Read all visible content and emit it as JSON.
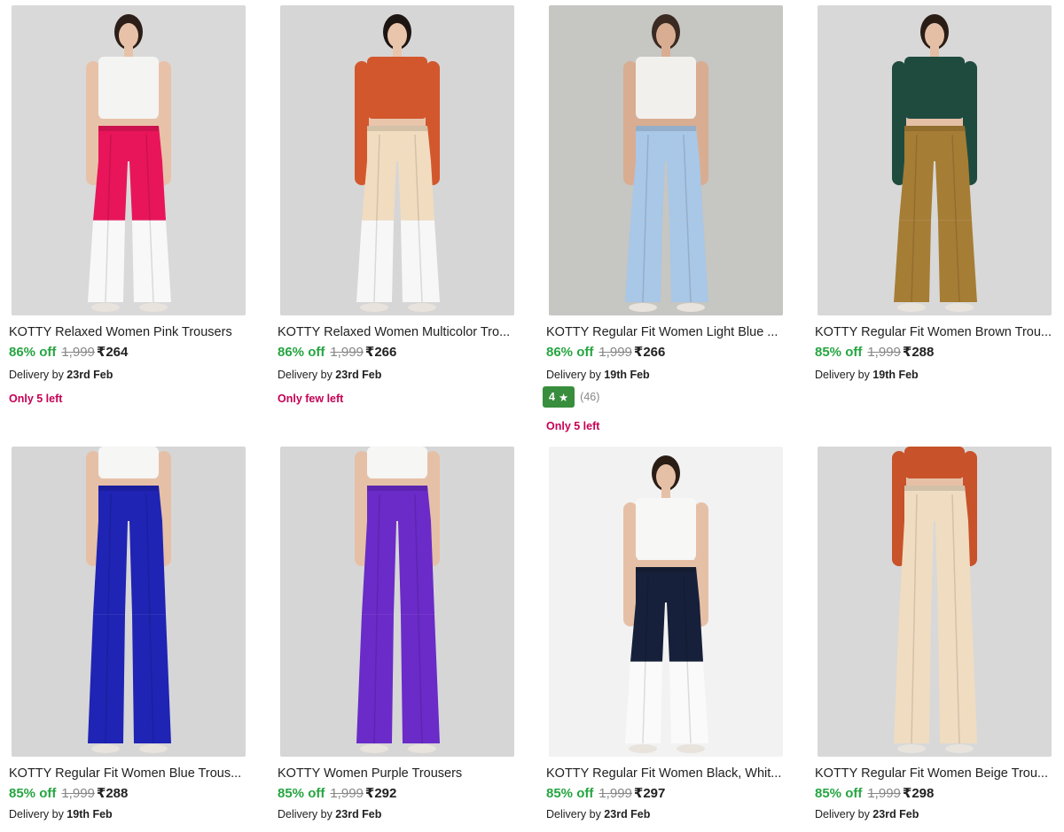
{
  "products": [
    {
      "title": "KOTTY Relaxed Women Pink Trousers",
      "discount": "86% off",
      "mrp": "1,999",
      "price": "₹264",
      "delivery_prefix": "Delivery by ",
      "delivery_date": "23rd Feb",
      "stock": "Only 5 left",
      "colors": {
        "bg": "#d9d9d9",
        "top": "#f4f4f2",
        "pants_upper": "#e8155a",
        "pants_lower": "#f8f8f8",
        "skin": "#e8c2a8",
        "hair": "#2c1e18"
      }
    },
    {
      "title": "KOTTY Relaxed Women Multicolor Tro...",
      "discount": "86% off",
      "mrp": "1,999",
      "price": "₹266",
      "delivery_prefix": "Delivery by ",
      "delivery_date": "23rd Feb",
      "stock": "Only few left",
      "colors": {
        "bg": "#d6d6d6",
        "top": "#d2572d",
        "pants_upper": "#f1dcc0",
        "pants_lower": "#f7f7f7",
        "skin": "#e9c5ac",
        "hair": "#1d1512"
      }
    },
    {
      "title": "KOTTY Regular Fit Women Light Blue ...",
      "discount": "86% off",
      "mrp": "1,999",
      "price": "₹266",
      "delivery_prefix": "Delivery by ",
      "delivery_date": "19th Feb",
      "rating": "4",
      "rating_count": "(46)",
      "stock": "Only 5 left",
      "colors": {
        "bg": "#c6c6c2",
        "top": "#f2f0ec",
        "pants_upper": "#a9c7e6",
        "pants_lower": "#a9c7e6",
        "skin": "#d9ad92",
        "hair": "#3a2a22"
      }
    },
    {
      "title": "KOTTY Regular Fit Women Brown Trou...",
      "discount": "85% off",
      "mrp": "1,999",
      "price": "₹288",
      "delivery_prefix": "Delivery by ",
      "delivery_date": "19th Feb",
      "colors": {
        "bg": "#d8d8d8",
        "top": "#1f4b3f",
        "pants_upper": "#a67d35",
        "pants_lower": "#a67d35",
        "skin": "#e4bfa6",
        "hair": "#2a1d16"
      }
    },
    {
      "title": "KOTTY Regular Fit Women Blue Trous...",
      "discount": "85% off",
      "mrp": "1,999",
      "price": "₹288",
      "delivery_prefix": "Delivery by ",
      "delivery_date": "19th Feb",
      "colors": {
        "bg": "#d6d6d6",
        "top": "#f6f6f4",
        "pants_upper": "#1f24b4",
        "pants_lower": "#1f24b4",
        "skin": "#e6c0a6",
        "hair": "#2a1d16"
      }
    },
    {
      "title": "KOTTY Women Purple Trousers",
      "discount": "85% off",
      "mrp": "1,999",
      "price": "₹292",
      "delivery_prefix": "Delivery by ",
      "delivery_date": "23rd Feb",
      "colors": {
        "bg": "#d6d6d6",
        "top": "#f6f6f4",
        "pants_upper": "#6a2bc8",
        "pants_lower": "#6a2bc8",
        "skin": "#e6c0a6",
        "hair": "#2a1d16"
      }
    },
    {
      "title": "KOTTY Regular Fit Women Black, Whit...",
      "discount": "85% off",
      "mrp": "1,999",
      "price": "₹297",
      "delivery_prefix": "Delivery by ",
      "delivery_date": "23rd Feb",
      "colors": {
        "bg": "#f2f2f2",
        "top": "#f7f7f5",
        "pants_upper": "#17203a",
        "pants_lower": "#fafafa",
        "skin": "#e6c0a6",
        "hair": "#2a1d16"
      }
    },
    {
      "title": "KOTTY Regular Fit Women Beige Trou...",
      "discount": "85% off",
      "mrp": "1,999",
      "price": "₹298",
      "delivery_prefix": "Delivery by ",
      "delivery_date": "23rd Feb",
      "colors": {
        "bg": "#d8d8d8",
        "top": "#c8522a",
        "pants_upper": "#f0dcc1",
        "pants_lower": "#f0dcc1",
        "skin": "#e6c0a6",
        "hair": "#1d1512"
      }
    }
  ]
}
